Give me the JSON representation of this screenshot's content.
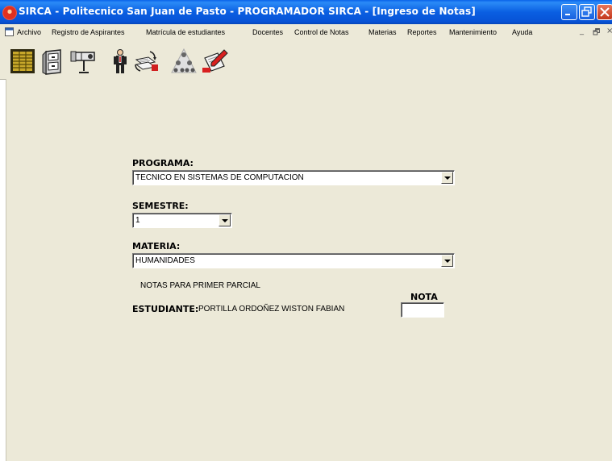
{
  "window": {
    "title": "SIRCA - Politecnico San Juan de Pasto - PROGRAMADOR SIRCA - [Ingreso de Notas]",
    "icon": "sirca-app-icon",
    "controls": [
      "minimize-icon",
      "restore-icon",
      "close-icon"
    ]
  },
  "menu": {
    "items": [
      {
        "label": "Archivo"
      },
      {
        "label": "Registro de Aspirantes"
      },
      {
        "label": "Matrícula de estudiantes"
      },
      {
        "label": "Docentes"
      },
      {
        "label": "Control de Notas"
      },
      {
        "label": "Materias"
      },
      {
        "label": "Reportes"
      },
      {
        "label": "Mantenimiento"
      },
      {
        "label": "Ayuda"
      }
    ],
    "mdi_controls": [
      "_",
      "🗗",
      "×"
    ]
  },
  "toolbar": {
    "tools": [
      "ledger-icon",
      "filing-cabinet-icon",
      "projector-icon",
      "person-icon",
      "document-transfer-icon",
      "hierarchy-icon",
      "notes-edit-icon"
    ]
  },
  "form": {
    "programa_label": "PROGRAMA:",
    "programa_value": "TECNICO EN SISTEMAS DE COMPUTACION",
    "semestre_label": "SEMESTRE:",
    "semestre_value": "1",
    "materia_label": "MATERIA:",
    "materia_value": "HUMANIDADES",
    "parcial_text": "NOTAS PARA PRIMER PARCIAL",
    "nota_header": "NOTA",
    "estudiante_label": "ESTUDIANTE:",
    "estudiante_name": "PORTILLA ORDOÑEZ WISTON FABIAN",
    "nota_value": ""
  },
  "colors": {
    "titlebar": "#0a5fe2",
    "face": "#ece9d8"
  }
}
